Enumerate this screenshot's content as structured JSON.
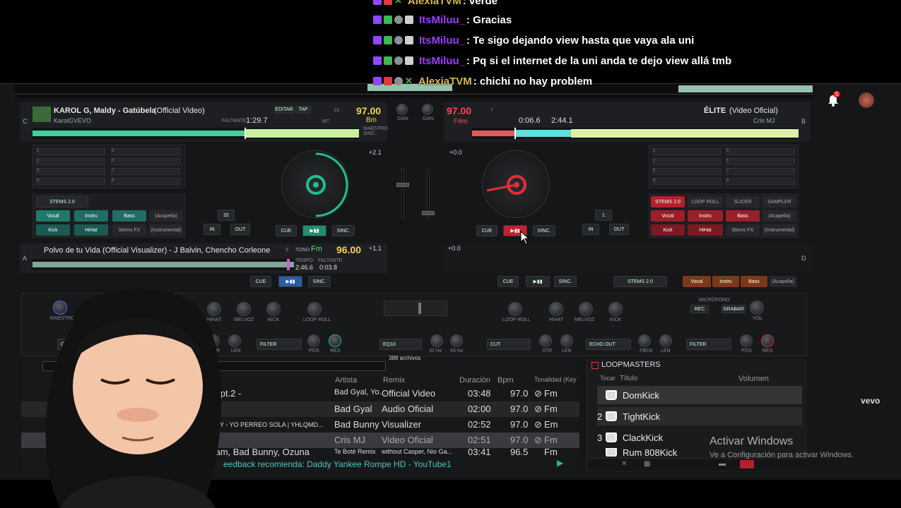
{
  "chat": {
    "messages": [
      {
        "user": "AlexiaTVM",
        "user_color": "#d6b84a",
        "text": " : verde"
      },
      {
        "user": "ItsMiluu_",
        "user_color": "#9b3cff",
        "text": " : Gracias"
      },
      {
        "user": "ItsMiluu_",
        "user_color": "#9b3cff",
        "text": " : Te sigo dejando view hasta que vaya ala uni"
      },
      {
        "user": "ItsMiluu_",
        "user_color": "#9b3cff",
        "text": " : Pq si el internet de la uni anda te dejo view allá tmb"
      },
      {
        "user": "AlexiaTVM",
        "user_color": "#d6b84a",
        "text": " : chichi no hay problem"
      }
    ]
  },
  "notifications": {
    "count": "5"
  },
  "deck_c": {
    "letter": "C",
    "title": "KAROL G, Maldy - Gatúbela",
    "title_suffix": "(Official Video)",
    "artist": "KarolGVEVO",
    "remaining": "1:29.7",
    "remaining_label": "FALTANTE",
    "edit": "EDITAR",
    "tap": "TAP",
    "bpm": "97.00",
    "key": "Bm",
    "key_value": "13",
    "master_sync": "MAESTRO SINC.",
    "mt": "MT",
    "pitch": "+2.1",
    "loop_size": "32",
    "stems": "STEMS 2.0",
    "pads": [
      "Vocal",
      "Instru",
      "Bass",
      "(Acapella)",
      "Kick",
      "HiHat",
      "Stems FX",
      "(Instrumental)"
    ],
    "cue": "CUE",
    "sync": "SINC.",
    "in": "IN",
    "out": "OUT",
    "hotcues": [
      "1",
      "2",
      "3",
      "4",
      "5",
      "6",
      "7",
      "8"
    ]
  },
  "deck_b": {
    "letter": "B",
    "title": "ÉLITE",
    "title_suffix": "(Video Oficial)",
    "artist": "Cris MJ",
    "bpm": "97.00",
    "key": "F#m",
    "key_value": "7",
    "elapsed": "0:06.6",
    "remaining": "2:44.1",
    "pitch": "+0.0",
    "loop_size": "1",
    "pads_top": [
      "STEMS 2.0",
      "LOOP ROLL",
      "SLICER",
      "SAMPLER"
    ],
    "pads": [
      "Vocal",
      "Instru",
      "Bass",
      "(Acapella)",
      "Kick",
      "HiHat",
      "Stems FX",
      "(Instrumental)"
    ],
    "cue": "CUE",
    "sync": "SINC.",
    "in": "IN",
    "out": "OUT",
    "hotcues": [
      "1",
      "2",
      "3",
      "4",
      "5",
      "6",
      "7",
      "8"
    ]
  },
  "deck_a": {
    "letter": "A",
    "title": "Polvo de tu Vida (Official Visualizer) - J Balvin, Chencho Corleone",
    "bpm": "96.00",
    "key": "Fm",
    "key_value": "9",
    "tone_label": "TONO",
    "tempo_label": "TEMPO",
    "remaining_label": "FALTANTE",
    "elapsed": "2:46.6",
    "remaining": "0:03.8",
    "pitch": "+1.1",
    "cue": "CUE",
    "sync": "SINC."
  },
  "deck_d": {
    "letter": "D",
    "pitch": "+0.0",
    "cue": "CUE",
    "sync": "SINC.",
    "stems": "STEMS 2.0",
    "pads": [
      "Vocal",
      "Instru",
      "Bass",
      "(Acapella)"
    ]
  },
  "mixer": {
    "gain": "GAN.",
    "master": "MAESTRO",
    "knobs_left": [
      "HIHAT",
      "MELVOZ",
      "KICK",
      "LOOP ROLL"
    ],
    "knobs_right": [
      "LOOP ROLL",
      "HIHAT",
      "MELVOZ",
      "KICK"
    ],
    "fx_left": [
      "CUT",
      "FILTER"
    ],
    "fx_mid": "EQ10",
    "fx_right": [
      "CUT",
      "ECHO OUT",
      "FILTER"
    ],
    "fx_knobs_left": [
      "STR",
      "LEN",
      "POS",
      "RES"
    ],
    "fx_knobs_mid": [
      "32 Hz",
      "63 Hz"
    ],
    "fx_knobs_right": [
      "STR",
      "LEN",
      "FBCK",
      "LEN",
      "POS",
      "RES"
    ],
    "mic_label": "MICRÓFONO",
    "mic_rec": "REC",
    "mic_record": "GRABAR",
    "vol": "VOL"
  },
  "browser": {
    "file_count": "388 archivos",
    "columns": [
      "Artista",
      "Remix",
      "Duración",
      "Bpm",
      "Tonalidad (Key"
    ],
    "rows": [
      {
        "title": "lo pt.2 -",
        "artist": "Bad Gyal, Yo...",
        "remix": "Official Video",
        "duration": "03:48",
        "bpm": "97.0",
        "key": "Fm"
      },
      {
        "title": "",
        "artist": "Bad Gyal",
        "remix": "Audio Oficial",
        "duration": "02:00",
        "bpm": "97.0",
        "key": "Fm"
      },
      {
        "title": "NNY - YO PERREO SOLA | YHLQMD...",
        "artist": "Bad Bunny",
        "remix": "Visualizer",
        "duration": "02:52",
        "bpm": "97.0",
        "key": "Em"
      },
      {
        "title": "",
        "artist": "Cris MJ",
        "remix": "Video Oficial",
        "duration": "02:51",
        "bpm": "97.0",
        "key": "Fm"
      },
      {
        "title": "Jam, Bad Bunny, Ozuna",
        "artist": "Te Boté Remix",
        "remix": "without Casper, Nio Ga...",
        "duration": "03:41",
        "bpm": "96.5",
        "key": "Fm"
      }
    ],
    "feedback": "eedback recomienda: Daddy Yankee Rompe HD - YouTube1"
  },
  "loopmasters": {
    "title": "LOOPMASTERS",
    "columns": [
      "Tocar",
      "Título",
      "Volumen"
    ],
    "items": [
      {
        "num": "",
        "name": "DomKick"
      },
      {
        "num": "2",
        "name": "TightKick"
      },
      {
        "num": "3",
        "name": "ClackKick"
      },
      {
        "num": "",
        "name": "Rum 808Kick"
      }
    ]
  },
  "watermark": {
    "line1": "Activar Windows",
    "line2": "Ve a Configuración para activar Windows."
  },
  "vevo": "vevo",
  "colors": {
    "deck_c_accent": "#1fbf8f",
    "deck_b_accent": "#e0303a",
    "bpm_green": "#46e07a",
    "bpm_red": "#ff4455",
    "bpm_yellow": "#f2d24a"
  }
}
